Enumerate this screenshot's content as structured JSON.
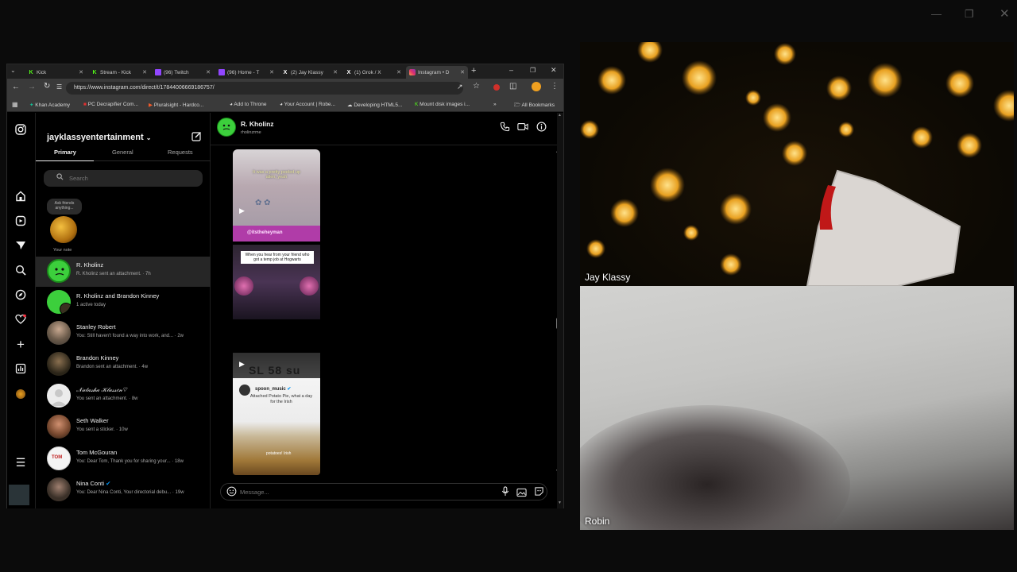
{
  "browser": {
    "tabs": [
      {
        "label": "Kick",
        "icon": "kick-icon",
        "color": "#53fc18"
      },
      {
        "label": "Stream - Kick",
        "icon": "kick-icon",
        "color": "#53fc18"
      },
      {
        "label": "(96) Twitch",
        "icon": "twitch-icon",
        "color": "#9146ff"
      },
      {
        "label": "(96) Home - T",
        "icon": "twitch-icon",
        "color": "#9146ff"
      },
      {
        "label": "(2) Jay Klassy",
        "icon": "x-icon",
        "color": "#ffffff"
      },
      {
        "label": "(1) Grok / X",
        "icon": "x-icon",
        "color": "#ffffff"
      },
      {
        "label": "Instagram • D",
        "icon": "instagram-icon",
        "color": "#e1306c"
      }
    ],
    "url": "https://www.instagram.com/direct/t/17844006669186757/",
    "bookmarks": [
      {
        "label": "Khan Academy",
        "icon": "leaf"
      },
      {
        "label": "PC Decrapifier Com...",
        "icon": "pc"
      },
      {
        "label": "Pluralsight - Hardco...",
        "icon": "ps"
      },
      {
        "label": "Add to Throne",
        "icon": "globe"
      },
      {
        "label": "Your Account | Robe...",
        "icon": "globe"
      },
      {
        "label": "Developing HTML5...",
        "icon": "cloud"
      },
      {
        "label": "Mount disk images i...",
        "icon": "k"
      }
    ],
    "all_bookmarks": "All Bookmarks"
  },
  "instagram": {
    "account": "jayklassyentertainment",
    "tabs": [
      "Primary",
      "General",
      "Requests"
    ],
    "search_placeholder": "Search",
    "note_bubble": "Ask friends anything...",
    "note_label": "Your note",
    "conversations": [
      {
        "name": "R. Kholinz",
        "preview": "R. Kholinz sent an attachment. · 7h",
        "avatar_color": "#3ccf3c",
        "selected": true
      },
      {
        "name": "R. Kholinz and Brandon Kinney",
        "preview": "1 active today",
        "avatar_color": "#3ccf3c",
        "selected": false
      },
      {
        "name": "Stanley Robert",
        "preview": "You: Still haven't found a way into work, and... · 2w",
        "avatar_color": "#7a6a5a",
        "selected": false
      },
      {
        "name": "Brandon Kinney",
        "preview": "Brandon sent an attachment. · 4w",
        "avatar_color": "#4a4030",
        "selected": false
      },
      {
        "name": "𝒩𝒶𝓉𝒶𝓈𝒽𝒶 𝒦𝓁𝒶𝓈𝓈𝑒𝓃♡",
        "preview": "You sent an attachment. · 8w",
        "avatar_color": "#e8e8e8",
        "selected": false
      },
      {
        "name": "Seth Walker",
        "preview": "You sent a sticker. · 10w",
        "avatar_color": "#8a5a3a",
        "selected": false
      },
      {
        "name": "Tom McGouran",
        "preview": "You: Dear Tom, Thank you for sharing your... · 18w",
        "avatar_color": "#f0f0f0",
        "selected": false
      },
      {
        "name": "Nina Conti",
        "preview": "You: Dear Nina Conti, Your directorial debu... · 19w",
        "avatar_color": "#5a4a40",
        "selected": false
      }
    ],
    "thread": {
      "name": "R. Kholinz",
      "handle": "rholinzrme",
      "media": [
        {
          "caption": "It was a pretty peeled up alien, yeah",
          "tag": "@itstheheyman"
        },
        {
          "caption": "When you hear from your friend who got a temp job at Hogwarts"
        },
        {
          "overlay": "SL 58 su",
          "user": "spoon_music",
          "text": "Attached Potato Pie, what a day for the Irish",
          "subtitle": "potatoes! Irish"
        }
      ],
      "message_placeholder": "Message..."
    }
  },
  "video": {
    "top_name": "Jay Klassy",
    "bottom_name": "Robin"
  }
}
